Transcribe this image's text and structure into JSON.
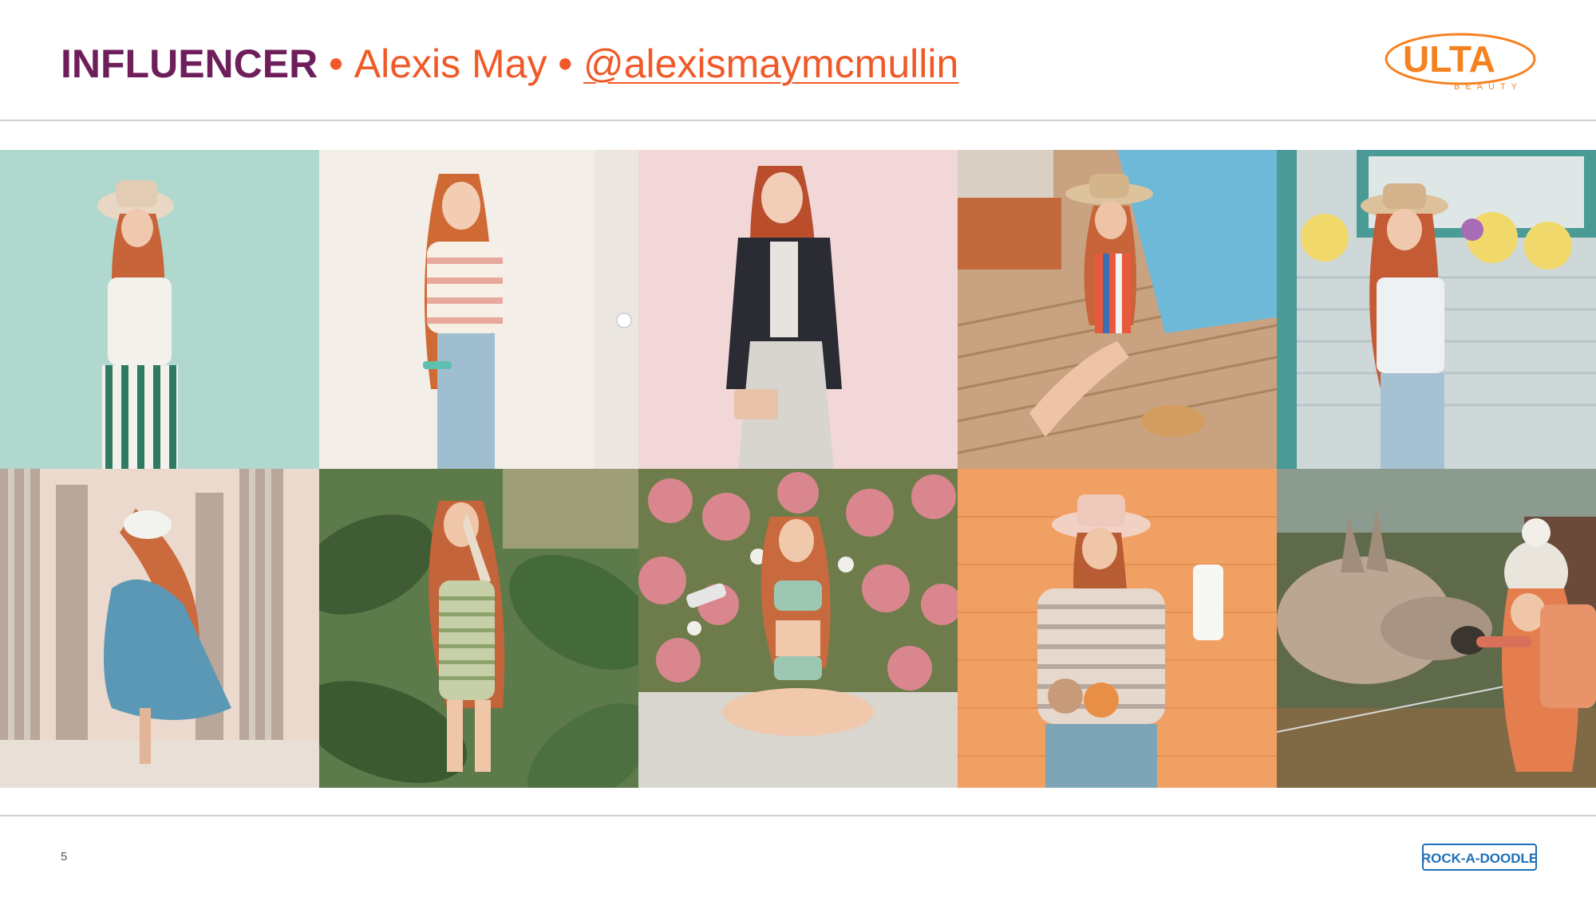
{
  "header": {
    "label": "INFLUENCER",
    "separator": "•",
    "name": "Alexis May",
    "handle": "@alexismaymcmullin"
  },
  "brand": {
    "logo_text": "ULTA",
    "logo_sub": "BEAUTY",
    "color": "#f58220"
  },
  "footer": {
    "page_number": "5",
    "badge_text": "ROCK-A-DOODLE",
    "badge_color": "#1d6fb8"
  },
  "photos": [
    {
      "subject": "woman in wide-brim hat, white tee and striped trousers against mint wall",
      "palette": [
        "#a9d4c9",
        "#f3e6d6",
        "#c8643a"
      ]
    },
    {
      "subject": "woman in striped sweater holding a hair straightener",
      "palette": [
        "#f3eee8",
        "#e8a99c",
        "#d06a35"
      ]
    },
    {
      "subject": "woman in black cardigan and pleated skirt against pink wall",
      "palette": [
        "#f2d7d8",
        "#2b2b33",
        "#b94d2c"
      ]
    },
    {
      "subject": "woman in striped swimsuit and sun hat sitting on a pool deck",
      "palette": [
        "#6fb9d8",
        "#c9a381",
        "#c7643a"
      ]
    },
    {
      "subject": "woman in sun hat by a window with flower boxes",
      "palette": [
        "#cfd8d9",
        "#4a9a95",
        "#c55b34"
      ]
    },
    {
      "subject": "woman in blue dress with head scarf among tiled columns",
      "palette": [
        "#ead9cc",
        "#5b98b6",
        "#cb6a3c"
      ]
    },
    {
      "subject": "woman in striped swimsuit among tropical leaves",
      "palette": [
        "#5d7a4a",
        "#c9b79a",
        "#c4643b"
      ]
    },
    {
      "subject": "woman in striped bikini sitting cross-legged before pink bougainvillea",
      "palette": [
        "#d9868f",
        "#9cc8b3",
        "#c86a3d"
      ]
    },
    {
      "subject": "woman in pink hat holding fruit and a bottle against orange wall",
      "palette": [
        "#f1a064",
        "#e6d8cc",
        "#b75c33"
      ]
    },
    {
      "subject": "woman in pom-pom beanie petting a donkey",
      "palette": [
        "#5f6a4b",
        "#bba694",
        "#e57e4e"
      ]
    }
  ]
}
